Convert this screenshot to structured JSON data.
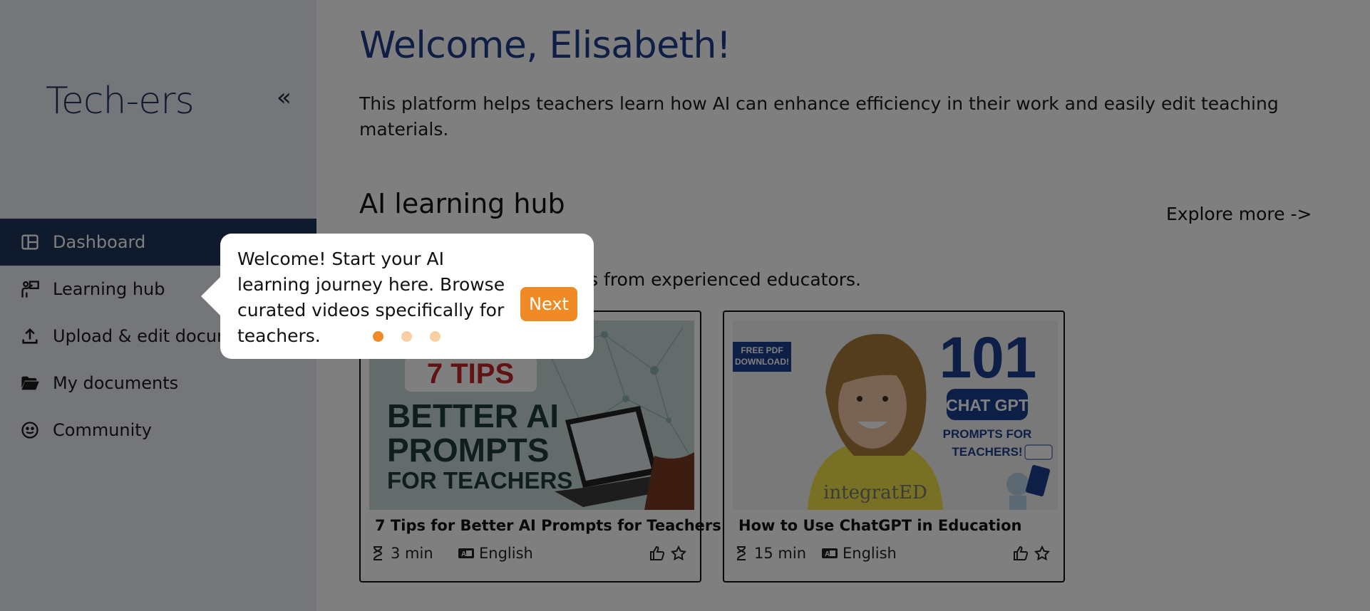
{
  "sidebar": {
    "logo": "Tech-ers",
    "collapse_icon": "double-chevron-left",
    "items": [
      {
        "label": "Dashboard",
        "icon": "dashboard-icon"
      },
      {
        "label": "Learning hub",
        "icon": "teacher-icon"
      },
      {
        "label": "Upload & edit documents",
        "icon": "upload-icon"
      },
      {
        "label": "My documents",
        "icon": "folder-open-icon"
      },
      {
        "label": "Community",
        "icon": "smiley-icon"
      }
    ]
  },
  "main": {
    "welcome": "Welcome, Elisabeth!",
    "intro": "This platform helps teachers learn how AI can enhance efficiency in their work and easily edit teaching materials.",
    "hub_title": "AI learning hub",
    "explore": "Explore more ->",
    "hub_subtitle": "Curated videos and guides from experienced educators.",
    "cards": [
      {
        "title": "7 Tips for Better AI Prompts for Teachers",
        "duration": "3 min",
        "language": "English",
        "thumb_lines": [
          "7 TIPS",
          "BETTER AI",
          "PROMPTS",
          "FOR TEACHERS"
        ]
      },
      {
        "title": "How to Use ChatGPT in Education",
        "duration": "15 min",
        "language": "English",
        "thumb_badge": "FREE PDF DOWNLOAD!",
        "thumb_number": "101",
        "thumb_pill": "CHAT GPT",
        "thumb_sub": "PROMPTS FOR TEACHERS!",
        "thumb_brand": "integratED"
      }
    ]
  },
  "tooltip": {
    "text": "Welcome! Start your AI learning journey here. Browse curated videos specifically for teachers.",
    "next_label": "Next",
    "step": 1,
    "total_steps": 3
  },
  "colors": {
    "brand_navy": "#1f3559",
    "accent_orange": "#f08a24",
    "heading_blue": "#1f3d8a"
  }
}
